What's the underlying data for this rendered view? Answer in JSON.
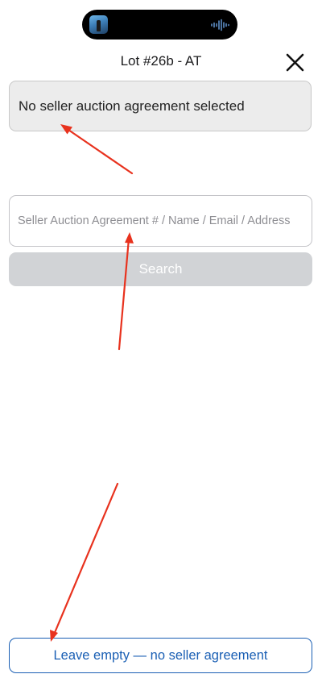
{
  "header": {
    "title": "Lot #26b - AT",
    "close_icon": "close-icon"
  },
  "status_island": {
    "thumbnail_icon": "media-thumbnail",
    "waveform_icon": "audio-waveform-icon"
  },
  "selected_agreement": {
    "text": "No seller auction agreement selected"
  },
  "search": {
    "placeholder": "Seller Auction Agreement # / Name / Email / Address",
    "value": "",
    "button_label": "Search",
    "button_state": "disabled"
  },
  "footer": {
    "leave_empty_label": "Leave empty — no seller agreement"
  },
  "colors": {
    "accent": "#1a5fb4",
    "annotation_arrow": "#e8321e",
    "disabled_button": "#d1d3d6",
    "selected_box_bg": "#ececec"
  }
}
